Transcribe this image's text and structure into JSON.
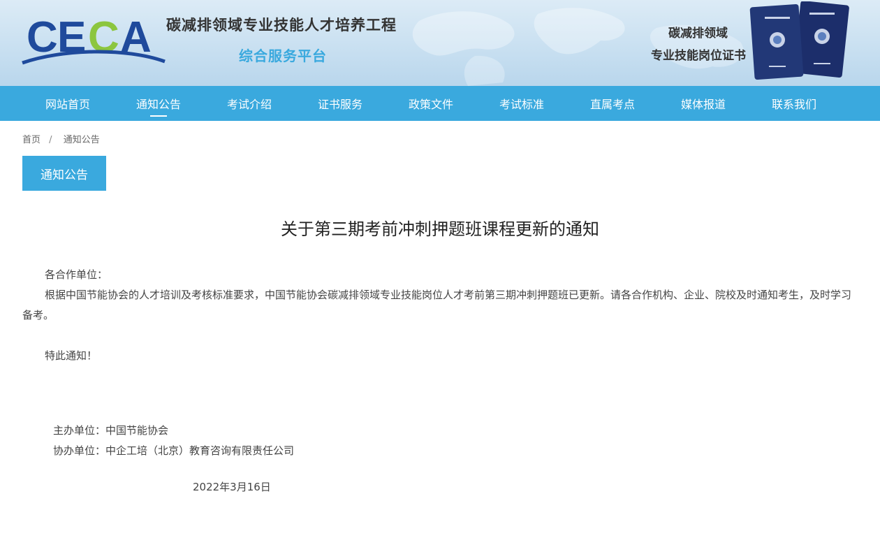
{
  "header": {
    "logo_text": "CECA",
    "title_main": "碳减排领域专业技能人才培养工程",
    "title_sub": "综合服务平台",
    "cert_line1": "碳减排领域",
    "cert_line2": "专业技能岗位证书",
    "book_label": "碳减排领域专业技能岗位证书"
  },
  "nav": {
    "items": [
      {
        "label": "网站首页"
      },
      {
        "label": "通知公告"
      },
      {
        "label": "考试介绍"
      },
      {
        "label": "证书服务"
      },
      {
        "label": "政策文件"
      },
      {
        "label": "考试标准"
      },
      {
        "label": "直属考点"
      },
      {
        "label": "媒体报道"
      },
      {
        "label": "联系我们"
      }
    ],
    "active_index": 1
  },
  "breadcrumb": {
    "home": "首页",
    "separator": "/",
    "current": "通知公告"
  },
  "section_tab": "通知公告",
  "article": {
    "title": "关于第三期考前冲刺押题班课程更新的通知",
    "salutation": "各合作单位：",
    "body": "根据中国节能协会的人才培训及考核标准要求，中国节能协会碳减排领域专业技能岗位人才考前第三期冲刺押题班已更新。请各合作机构、企业、院校及时通知考生，及时学习备考。",
    "closing": "特此通知！",
    "host_org": "主办单位：中国节能协会",
    "co_org": "协办单位：中企工培（北京）教育咨询有限责任公司",
    "date": "2022年3月16日"
  },
  "colors": {
    "primary": "#3aa9de",
    "logo_blue": "#1f4a9c",
    "logo_green": "#8cc63f"
  }
}
